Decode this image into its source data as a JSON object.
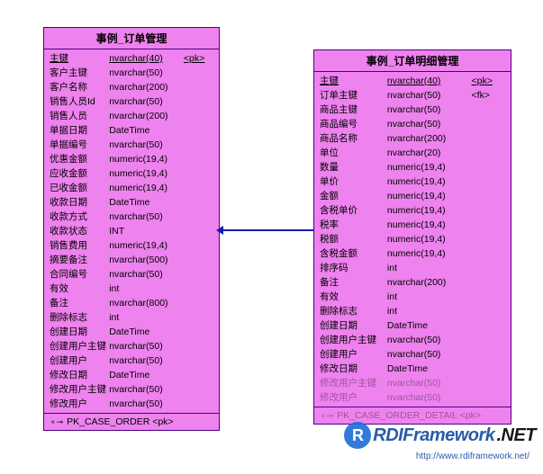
{
  "table_left": {
    "title": "事例_订单管理",
    "rows": [
      {
        "name": "主键",
        "type": "nvarchar(40)",
        "key": "<pk>",
        "pk": true
      },
      {
        "name": "客户主键",
        "type": "nvarchar(50)",
        "key": ""
      },
      {
        "name": "客户名称",
        "type": "nvarchar(200)",
        "key": ""
      },
      {
        "name": "销售人员Id",
        "type": "nvarchar(50)",
        "key": ""
      },
      {
        "name": "销售人员",
        "type": "nvarchar(200)",
        "key": ""
      },
      {
        "name": "单据日期",
        "type": "DateTime",
        "key": ""
      },
      {
        "name": "单据编号",
        "type": "nvarchar(50)",
        "key": ""
      },
      {
        "name": "优惠金额",
        "type": "numeric(19,4)",
        "key": ""
      },
      {
        "name": "应收金额",
        "type": "numeric(19,4)",
        "key": ""
      },
      {
        "name": "已收金额",
        "type": "numeric(19,4)",
        "key": ""
      },
      {
        "name": "收款日期",
        "type": "DateTime",
        "key": ""
      },
      {
        "name": "收款方式",
        "type": "nvarchar(50)",
        "key": ""
      },
      {
        "name": "收款状态",
        "type": "INT",
        "key": ""
      },
      {
        "name": "销售费用",
        "type": "numeric(19,4)",
        "key": ""
      },
      {
        "name": "摘要备注",
        "type": "nvarchar(500)",
        "key": ""
      },
      {
        "name": "合同编号",
        "type": "nvarchar(50)",
        "key": ""
      },
      {
        "name": "有效",
        "type": "int",
        "key": ""
      },
      {
        "name": "备注",
        "type": "nvarchar(800)",
        "key": ""
      },
      {
        "name": "删除标志",
        "type": "int",
        "key": ""
      },
      {
        "name": "创建日期",
        "type": "DateTime",
        "key": ""
      },
      {
        "name": "创建用户主键",
        "type": "nvarchar(50)",
        "key": ""
      },
      {
        "name": "创建用户",
        "type": "nvarchar(50)",
        "key": ""
      },
      {
        "name": "修改日期",
        "type": "DateTime",
        "key": ""
      },
      {
        "name": "修改用户主键",
        "type": "nvarchar(50)",
        "key": ""
      },
      {
        "name": "修改用户",
        "type": "nvarchar(50)",
        "key": ""
      }
    ],
    "footer": "PK_CASE_ORDER  <pk>"
  },
  "table_right": {
    "title": "事例_订单明细管理",
    "rows": [
      {
        "name": "主键",
        "type": "nvarchar(40)",
        "key": "<pk>",
        "pk": true
      },
      {
        "name": "订单主键",
        "type": "nvarchar(50)",
        "key": "<fk>"
      },
      {
        "name": "商品主键",
        "type": "nvarchar(50)",
        "key": ""
      },
      {
        "name": "商品编号",
        "type": "nvarchar(50)",
        "key": ""
      },
      {
        "name": "商品名称",
        "type": "nvarchar(200)",
        "key": ""
      },
      {
        "name": "单位",
        "type": "nvarchar(20)",
        "key": ""
      },
      {
        "name": "数量",
        "type": "numeric(19,4)",
        "key": ""
      },
      {
        "name": "单价",
        "type": "numeric(19,4)",
        "key": ""
      },
      {
        "name": "金额",
        "type": "numeric(19,4)",
        "key": ""
      },
      {
        "name": "含税单价",
        "type": "numeric(19,4)",
        "key": ""
      },
      {
        "name": "税率",
        "type": "numeric(19,4)",
        "key": ""
      },
      {
        "name": "税额",
        "type": "numeric(19,4)",
        "key": ""
      },
      {
        "name": "含税金额",
        "type": "numeric(19,4)",
        "key": ""
      },
      {
        "name": "排序码",
        "type": "int",
        "key": ""
      },
      {
        "name": "备注",
        "type": "nvarchar(200)",
        "key": ""
      },
      {
        "name": "有效",
        "type": "int",
        "key": ""
      },
      {
        "name": "删除标志",
        "type": "int",
        "key": ""
      },
      {
        "name": "创建日期",
        "type": "DateTime",
        "key": ""
      },
      {
        "name": "创建用户主键",
        "type": "nvarchar(50)",
        "key": ""
      },
      {
        "name": "创建用户",
        "type": "nvarchar(50)",
        "key": ""
      },
      {
        "name": "修改日期",
        "type": "DateTime",
        "key": ""
      },
      {
        "name": "修改用户主键",
        "type": "nvarchar(50)",
        "key": "",
        "faded": true
      },
      {
        "name": "修改用户",
        "type": "nvarchar(50)",
        "key": "",
        "faded": true
      }
    ],
    "footer": "PK_CASE_ORDER_DETAIL  <pk>"
  },
  "watermark": {
    "text": "RDIFramework",
    "net": ".NET",
    "url": "http://www.rdiframework.net/"
  }
}
